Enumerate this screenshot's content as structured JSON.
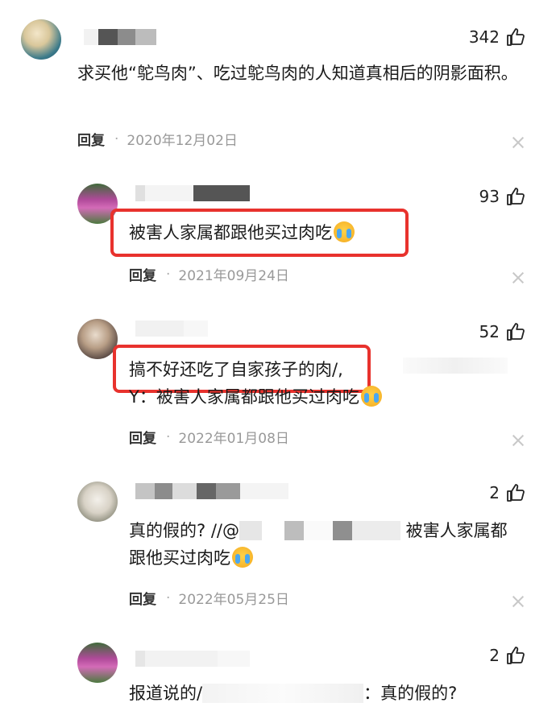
{
  "comments": [
    {
      "likes": "342",
      "text": "求买他“鸵鸟肉”、吃过鸵鸟肉的人知道真相后的阴影面积。",
      "reply_label": "回复",
      "date": "2020年12月02日"
    },
    {
      "likes": "93",
      "text": "被害人家属都跟他买过肉吃",
      "reply_label": "回复",
      "date": "2021年09月24日"
    },
    {
      "likes": "52",
      "text": "搞不好还吃了自家孩子的肉/,",
      "quote": "Y：被害人家属都跟他买过肉吃",
      "reply_label": "回复",
      "date": "2022年01月08日"
    },
    {
      "likes": "2",
      "text_prefix": "真的假的? //@",
      "text_suffix": "被害人家属都",
      "text_line2": "跟他买过肉吃",
      "reply_label": "回复",
      "date": "2022年05月25日"
    },
    {
      "likes": "2",
      "text_prefix": "报道说的/",
      "text_suffix": "：真的假的?"
    }
  ],
  "icons": {
    "like": "thumbs-up-icon",
    "close": "close-icon",
    "emoji": "crying-face-emoji"
  },
  "colors": {
    "highlight": "#e8322d",
    "meta": "#999999"
  }
}
